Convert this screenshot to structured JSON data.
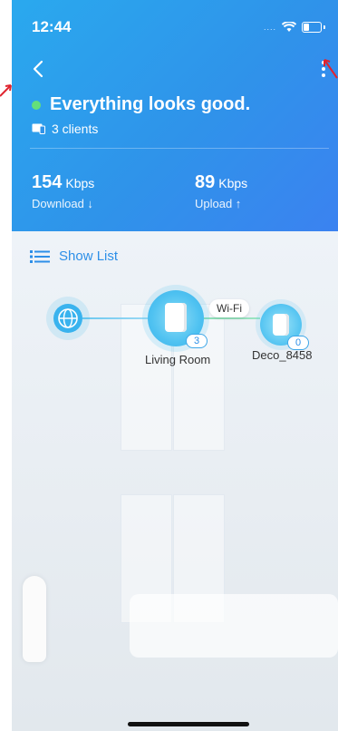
{
  "status_bar": {
    "time": "12:44",
    "signal_dots": "....",
    "wifi_icon": "wifi-icon",
    "battery_icon": "battery-icon"
  },
  "header": {
    "back_icon": "chevron-left-icon",
    "more_icon": "more-vertical-icon",
    "status_text": "Everything looks good.",
    "status_color": "#64e07a",
    "clients_icon": "device-icon",
    "clients_text": "3 clients",
    "background": "#2f93ea"
  },
  "stats": {
    "download": {
      "value": "154",
      "unit": "Kbps",
      "label": "Download ↓"
    },
    "upload": {
      "value": "89",
      "unit": "Kbps",
      "label": "Upload ↑"
    }
  },
  "show_list": {
    "icon": "list-icon",
    "label": "Show List",
    "color": "#2d8fe8"
  },
  "topology": {
    "internet_icon": "globe-icon",
    "main_node": {
      "label": "Living Room",
      "clients": "3"
    },
    "link_label": "Wi-Fi",
    "satellite_node": {
      "label": "Deco_8458",
      "clients": "0"
    }
  },
  "annotation": {
    "color": "#e0242f"
  }
}
